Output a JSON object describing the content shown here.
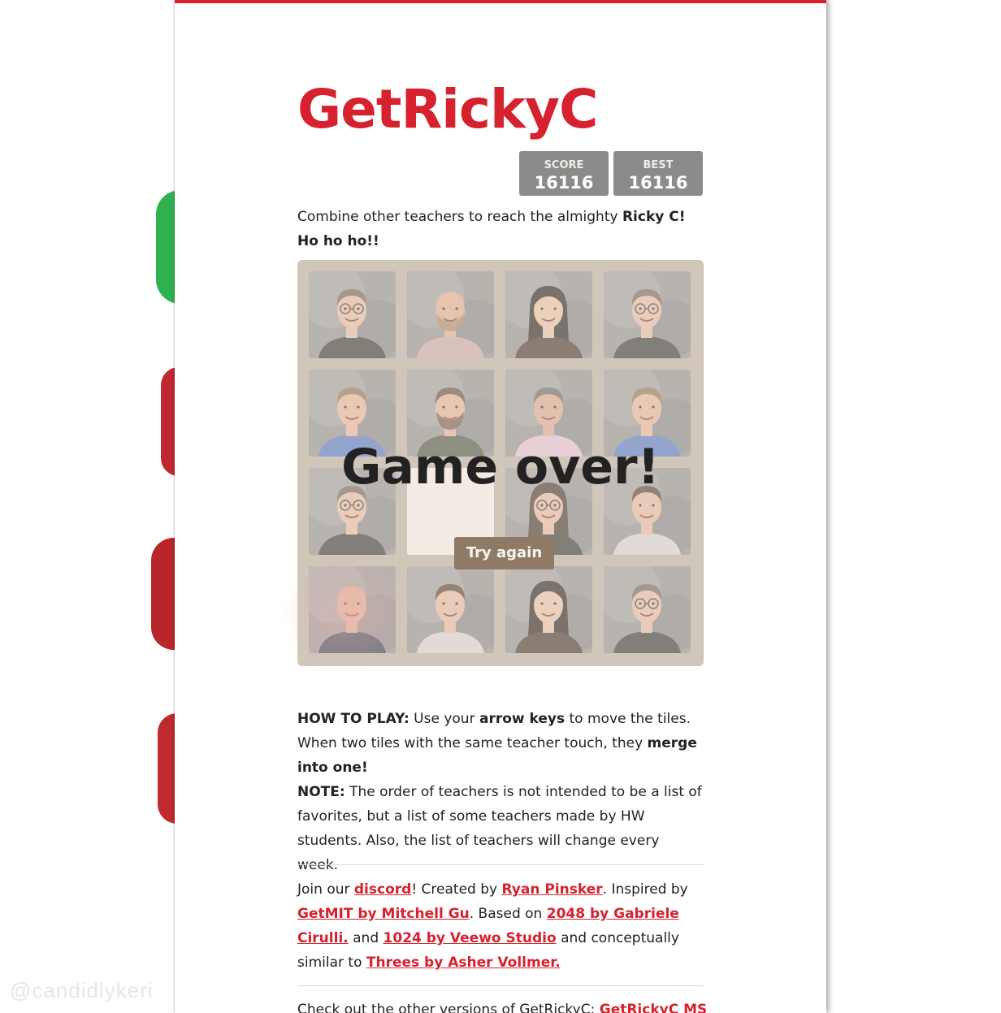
{
  "app": {
    "title": "GetRickyC",
    "accent_color": "#d6222f"
  },
  "scores": {
    "score_label": "SCORE",
    "score_value": "16116",
    "best_label": "BEST",
    "best_value": "16116"
  },
  "intro": {
    "text_plain": "Combine other teachers to reach the almighty ",
    "text_bold": "Ricky C! Ho ho ho!!"
  },
  "board": {
    "rows": [
      [
        "teacher-glasses-gray",
        "teacher-bald-beard",
        "teacher-woman-black-hair",
        "teacher-glasses-gray"
      ],
      [
        "teacher-blue-shirt",
        "teacher-beard-brown",
        "teacher-pink-shirt",
        "teacher-blue-shirt"
      ],
      [
        "teacher-glasses-gray",
        "empty",
        "teacher-woman-glasses",
        "teacher-plaid-shirt"
      ],
      [
        "teacher-bald-navy",
        "teacher-plaid-shirt",
        "teacher-woman-black-hair",
        "teacher-glasses-gray"
      ]
    ],
    "game_over_text": "Game over!",
    "try_again_label": "Try again"
  },
  "howto": {
    "label": "HOW TO PLAY:",
    "p1": " Use your ",
    "arrow_keys": "arrow keys",
    "p2": " to move the tiles. When two tiles with the same teacher touch, they ",
    "merge": "merge into one!",
    "note_label": "NOTE:",
    "note_text": " The order of teachers is not intended to be a list of favorites, but a list of some teachers made by HW students. Also, the list of teachers will change every week."
  },
  "credits": {
    "t1": "Join our ",
    "discord": "discord",
    "t2": "! Created by ",
    "ryan": "Ryan Pinsker",
    "t3": ". Inspired by ",
    "getmit": "GetMIT by Mitchell Gu",
    "t4": ". Based on ",
    "g2048": "2048 by Gabriele Cirulli.",
    "t5": " and ",
    "v1024": "1024 by Veewo Studio",
    "t6": " and conceptually similar to ",
    "threes": "Threes by Asher Vollmer."
  },
  "more": {
    "text": "Check out the other versions of GetRickyC: ",
    "link": "GetRickyC MS"
  },
  "watermark": "@candidlykeri"
}
